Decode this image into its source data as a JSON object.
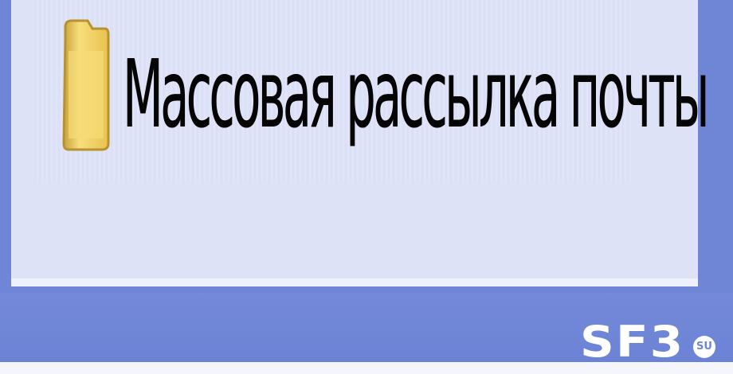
{
  "folder": {
    "label": "Массовая рассылка почты",
    "icon": "folder-icon"
  },
  "watermark": {
    "brand": "SF3",
    "domain": "SU"
  },
  "colors": {
    "frame": "#6f86d6",
    "panel": "#dde2f7",
    "folder_fill": "#f3d36a",
    "folder_edge": "#b8922c",
    "text": "#050505"
  }
}
